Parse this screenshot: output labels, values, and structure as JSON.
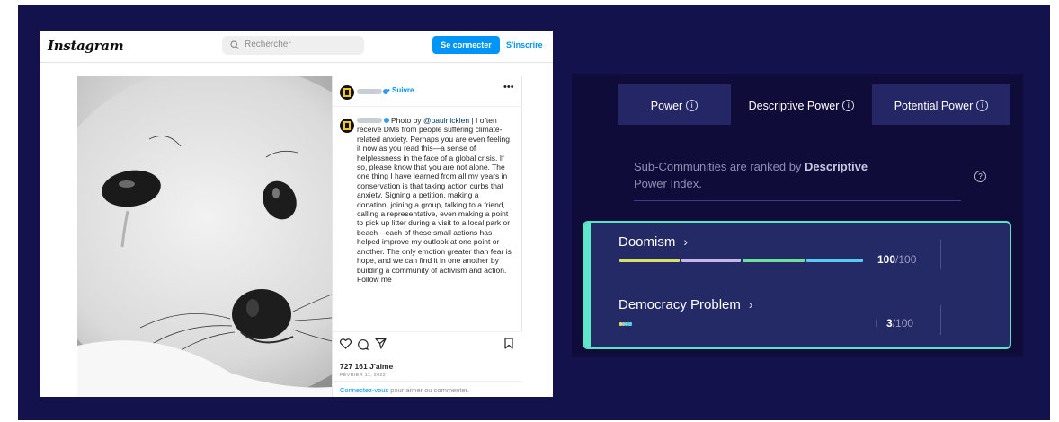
{
  "instagram": {
    "logo": "Instagram",
    "search_placeholder": "Rechercher",
    "connect_label": "Se connecter",
    "signup_label": "S'inscrire",
    "follow_label": "• Suivre",
    "more_label": "•••",
    "caption_handle": "@paulnicklen",
    "caption_prefix": "Photo by",
    "caption_body": "| I often receive DMs from people suffering climate-related anxiety. Perhaps you are even feeling it now as you read this—a sense of helplessness in the face of a global crisis. If so, please know that you are not alone. The one thing I have learned from all my years in conservation is that taking action curbs that anxiety. Signing a petition, making a donation, joining a group, talking to a friend, calling a representative, even making a point to pick up litter during a visit to a local park or beach—each of these small actions has helped improve my outlook at one point or another. The only emotion greater than fear is hope, and we can find it in one another by building a community of activism and action. Follow me",
    "likes": "727 161 J'aime",
    "date": "FÉVRIER 11, 2022",
    "login_link": "Connectez-vous",
    "login_rest": " pour aimer ou commenter.",
    "icons": [
      "search-icon",
      "heart-icon",
      "comment-icon",
      "share-icon",
      "bookmark-icon",
      "chevron-right-icon",
      "more-icon",
      "verified-icon"
    ]
  },
  "power_panel": {
    "tabs": [
      {
        "label": "Power",
        "active": false
      },
      {
        "label": "Descriptive Power",
        "active": true
      },
      {
        "label": "Potential Power",
        "active": false
      }
    ],
    "description_prefix": "Sub-Communities are ranked by ",
    "description_bold": "Descriptive",
    "description_suffix": "Power Index.",
    "items": [
      {
        "name": "Doomism",
        "score": "100",
        "max": "/100",
        "value": 100,
        "segments": [
          "#d8e06a",
          "#c4b8e6",
          "#6ddf9a",
          "#5bc9f0"
        ]
      },
      {
        "name": "Democracy Problem",
        "score": "3",
        "max": "/100",
        "value": 3,
        "segments": [
          "#d8e06a",
          "#c4b8e6",
          "#6ddf9a",
          "#5bc9f0"
        ]
      }
    ],
    "colors": {
      "accent": "#59e2c5",
      "tab_inactive": "#242666",
      "background": "#0f0c3a",
      "highlight": "#232a65"
    }
  }
}
